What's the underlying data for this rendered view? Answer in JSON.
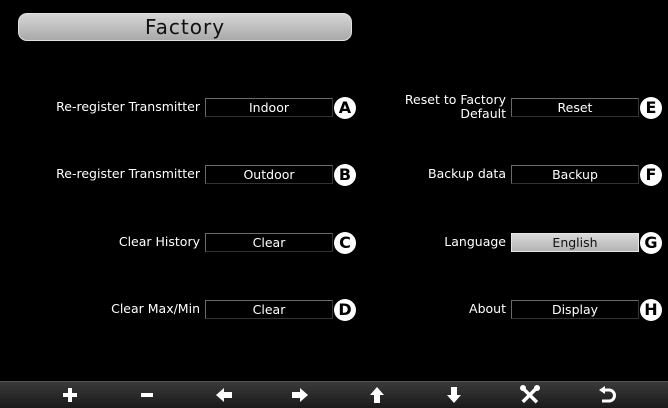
{
  "header": {
    "title": "Factory"
  },
  "left_rows": [
    {
      "label": "Re-register Transmitter",
      "value": "Indoor",
      "badge": "A"
    },
    {
      "label": "Re-register Transmitter",
      "value": "Outdoor",
      "badge": "B"
    },
    {
      "label": "Clear History",
      "value": "Clear",
      "badge": "C"
    },
    {
      "label": "Clear Max/Min",
      "value": "Clear",
      "badge": "D"
    }
  ],
  "right_rows": [
    {
      "label_line1": "Reset to Factory",
      "label_line2": "Default",
      "value": "Reset",
      "badge": "E"
    },
    {
      "label": "Backup data",
      "value": "Backup",
      "badge": "F"
    },
    {
      "label": "Language",
      "value": "English",
      "badge": "G",
      "selected": true
    },
    {
      "label": "About",
      "value": "Display",
      "badge": "H"
    }
  ],
  "toolbar": {
    "icons": [
      "plus-icon",
      "minus-icon",
      "arrow-left-icon",
      "arrow-right-icon",
      "arrow-up-icon",
      "arrow-down-icon",
      "tools-icon",
      "return-icon"
    ]
  },
  "colors": {
    "background": "#000000",
    "title_bar": "#c0c0c0",
    "selected_field": "#c8c8c8"
  }
}
